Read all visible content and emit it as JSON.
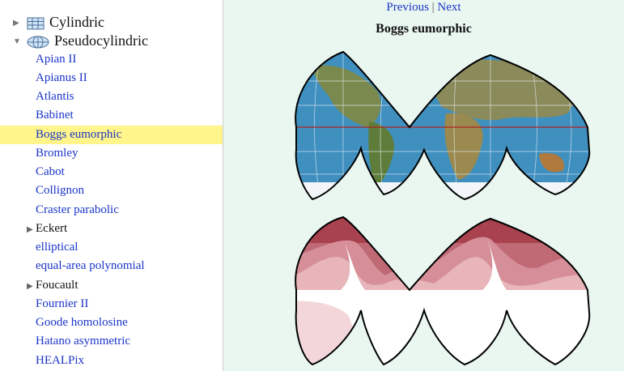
{
  "sidebar": {
    "categories": [
      {
        "label": "Cylindric",
        "expanded": false,
        "icon": "cylindric-grid-icon"
      },
      {
        "label": "Pseudocylindric",
        "expanded": true,
        "icon": "pseudocylindric-globe-icon"
      }
    ],
    "items": [
      {
        "label": "Apian II"
      },
      {
        "label": "Apianus II"
      },
      {
        "label": "Atlantis"
      },
      {
        "label": "Babinet"
      },
      {
        "label": "Boggs eumorphic",
        "selected": true
      },
      {
        "label": "Bromley"
      },
      {
        "label": "Cabot"
      },
      {
        "label": "Collignon"
      },
      {
        "label": "Craster parabolic"
      },
      {
        "label": "Eckert",
        "folder": true
      },
      {
        "label": "elliptical"
      },
      {
        "label": "equal-area polynomial"
      },
      {
        "label": "Foucault",
        "folder": true
      },
      {
        "label": "Fournier II"
      },
      {
        "label": "Goode homolosine"
      },
      {
        "label": "Hatano asymmetric"
      },
      {
        "label": "HEALPix"
      }
    ]
  },
  "main": {
    "nav": {
      "previous": "Previous",
      "separator": "|",
      "next": "Next"
    },
    "title": "Boggs eumorphic"
  },
  "colors": {
    "link": "#1a35c9",
    "selection": "#fff58a",
    "background": "#eaf7f0",
    "ocean": "#3f8fbf",
    "equator": "#b02020",
    "distortion": [
      "#a8424f",
      "#c06a76",
      "#d68f98",
      "#e7b5ba",
      "#ffffff"
    ]
  }
}
